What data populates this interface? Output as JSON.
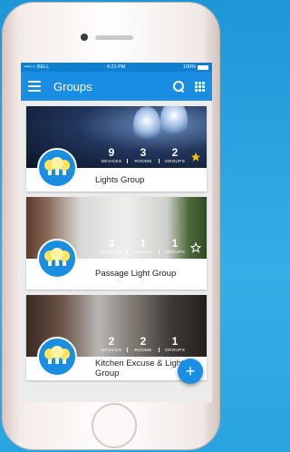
{
  "status_bar": {
    "carrier": "•••○○ BELL",
    "time": "4:21 PM",
    "battery": "100%"
  },
  "app_bar": {
    "title": "Groups"
  },
  "groups": [
    {
      "name": "Lights Group",
      "devices": "9",
      "rooms": "3",
      "groups": "2",
      "favorite": true
    },
    {
      "name": "Passage Light Group",
      "devices": "3",
      "rooms": "1",
      "groups": "1",
      "favorite": false
    },
    {
      "name": "Kitchen Excuse & Light Group",
      "devices": "2",
      "rooms": "2",
      "groups": "1",
      "favorite": false
    }
  ],
  "labels": {
    "devices": "DEVICES",
    "rooms": "ROOMS",
    "groups": "GROUPS"
  },
  "fab_label": "+",
  "colors": {
    "primary": "#1a8ee2",
    "status_bar": "#0f7fcf",
    "star": "#f5c400"
  }
}
